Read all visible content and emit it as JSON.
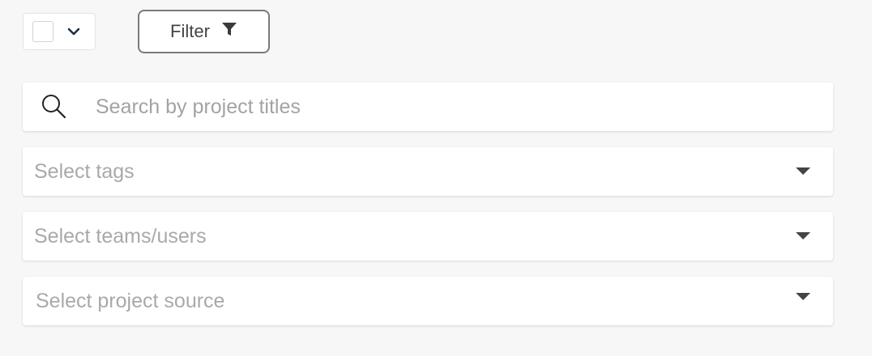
{
  "toolbar": {
    "filter_label": "Filter"
  },
  "search": {
    "placeholder": "Search by project titles"
  },
  "dropdowns": {
    "tags": "Select tags",
    "teams": "Select teams/users",
    "source": "Select project source"
  },
  "icons": {
    "select_all_chevron": "chevron-down-icon",
    "filter": "filter-icon",
    "search": "search-icon",
    "dropdown_caret": "caret-down-icon"
  },
  "colors": {
    "background": "#f7f7f7",
    "placeholder": "#a9a9a9",
    "chevron": "#1f3147"
  }
}
